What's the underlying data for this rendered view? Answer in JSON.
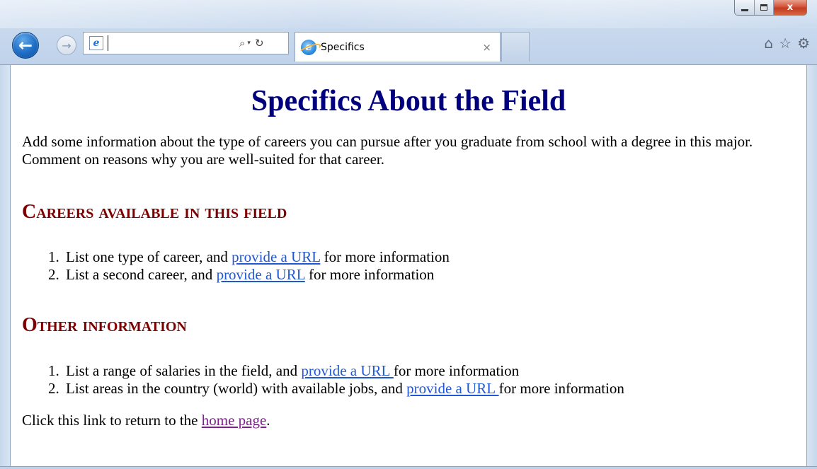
{
  "window": {
    "minimize_label": "",
    "maximize_label": "",
    "close_label": "x"
  },
  "toolbar": {
    "back_icon": "←",
    "forward_icon": "→",
    "address_value": "",
    "search_icon": "⌕",
    "dropdown_icon": "▾",
    "refresh_icon": "↻",
    "home_icon": "⌂",
    "favorites_icon": "☆",
    "settings_icon": "⚙"
  },
  "tab": {
    "title": "Specifics",
    "close": "×"
  },
  "page": {
    "title": "Specifics About the Field",
    "intro": "Add some information about the type of careers you can pursue after you graduate from school with a degree in this major. Comment on reasons why you are well-suited for that career.",
    "sections": [
      {
        "heading": "Careers available in this field",
        "items": [
          {
            "before": "List one type of career, and ",
            "link": "provide a URL",
            "after": " for more information"
          },
          {
            "before": "List a second career, and ",
            "link": "provide a URL",
            "after": " for more information"
          }
        ]
      },
      {
        "heading": "Other information",
        "items": [
          {
            "before": "List a range of salaries in the field, and ",
            "link": "provide a URL ",
            "after": "for more information"
          },
          {
            "before": "List areas in the country (world) with available jobs, and ",
            "link": "provide a URL ",
            "after": "for more information"
          }
        ]
      }
    ],
    "footer": {
      "before": "Click this link to return to the ",
      "link": "home page",
      "after": "."
    }
  },
  "colors": {
    "title": "#00007f",
    "section_heading": "#7f0000",
    "link": "#1f57d6",
    "visited_link": "#7f1f8f"
  }
}
